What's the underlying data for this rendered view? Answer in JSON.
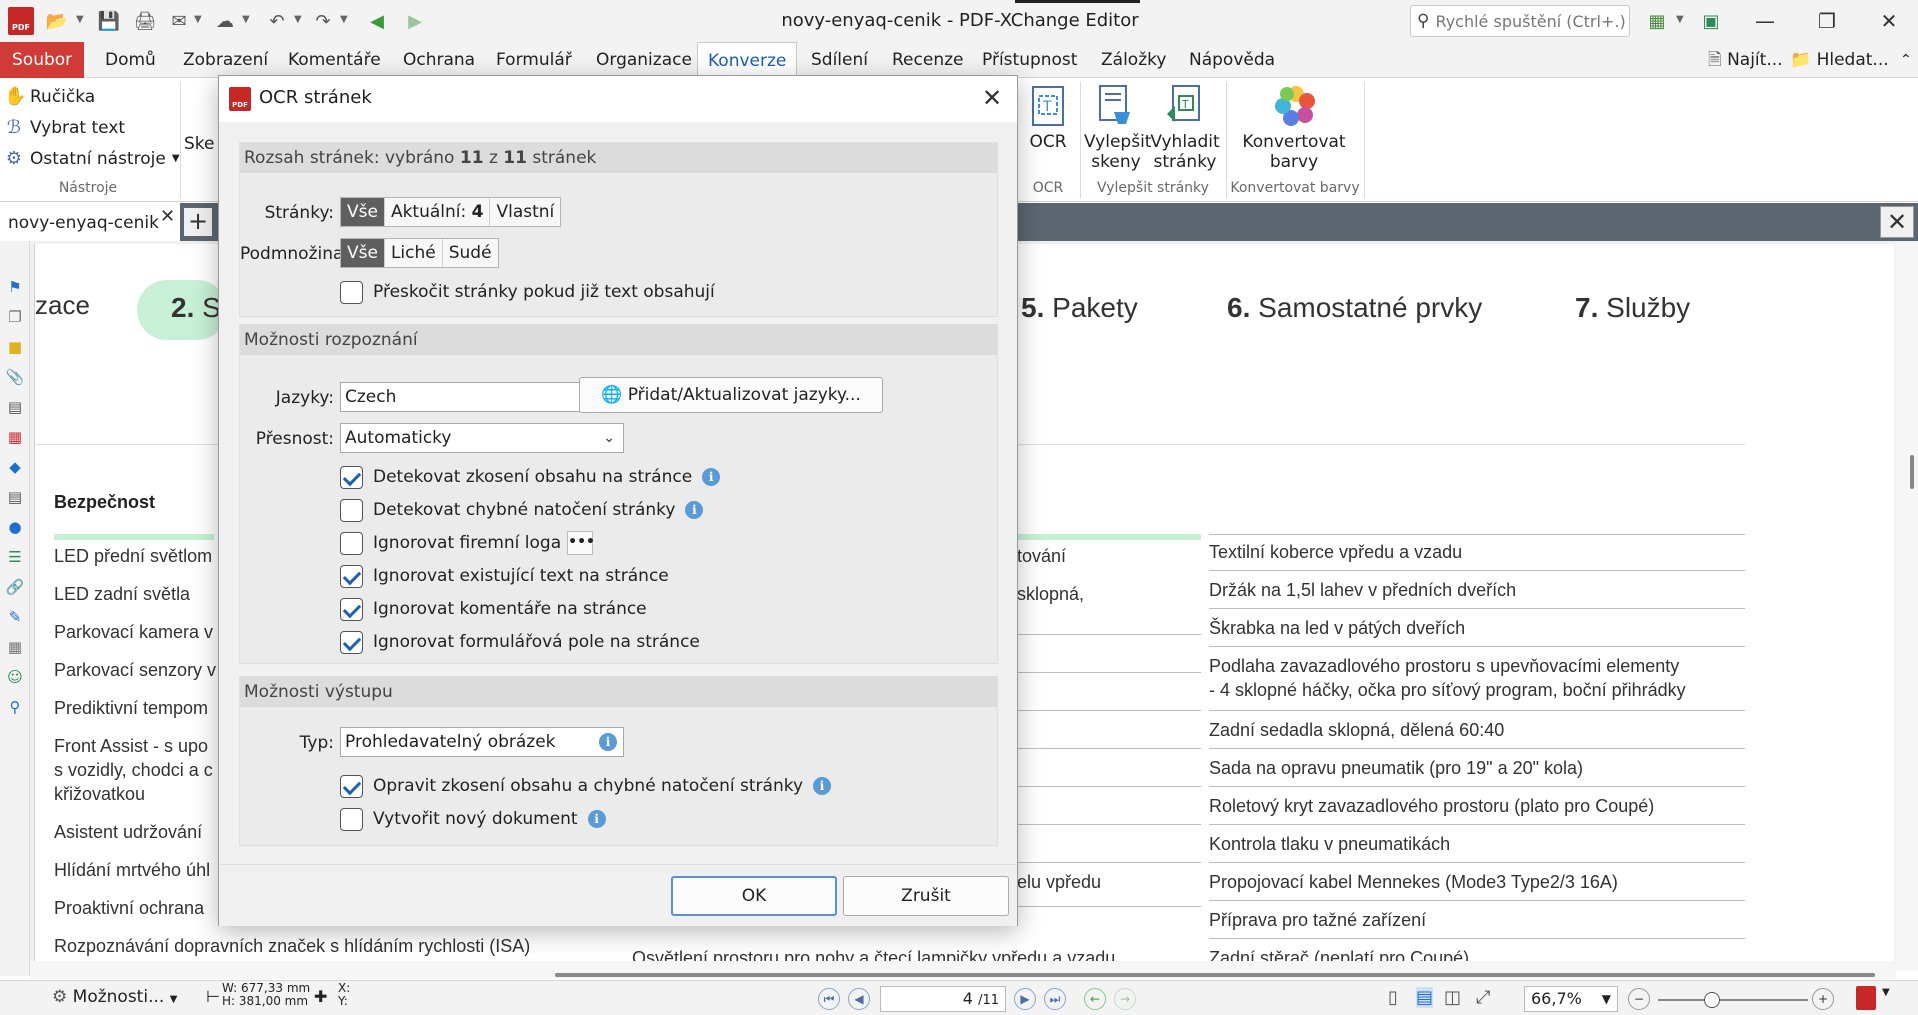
{
  "window": {
    "title": "novy-enyaq-cenik - PDF-XChange Editor",
    "quick_launch_placeholder": "Rychlé spuštění (Ctrl+.)",
    "logo_text": "PDF"
  },
  "menu": {
    "file": "Soubor",
    "items": [
      "Domů",
      "Zobrazení",
      "Komentáře",
      "Ochrana",
      "Formulář",
      "Organizace",
      "Konverze",
      "Sdílení",
      "Recenze",
      "Přístupnost",
      "Záložky",
      "Nápověda"
    ],
    "active": "Konverze",
    "find": "Najít...",
    "search": "Hledat..."
  },
  "ribbon": {
    "tools": [
      "Ručička",
      "Vybrat text",
      "Ostatní nástroje"
    ],
    "tools_group": "Nástroje",
    "partial_button": "Ske",
    "ocr_button": "OCR",
    "ocr_group": "OCR",
    "enhance_button": "Vylepšit skeny",
    "enhance_line1": "Vylepšit",
    "enhance_line2": "skeny",
    "smooth_line1": "Vyhladit",
    "smooth_line2": "stránky",
    "enhance_group": "Vylepšit stránky",
    "convert_line1": "Konvertovat",
    "convert_line2": "barvy",
    "convert_group": "Konvertovat barvy"
  },
  "tabs": {
    "doc": "novy-enyaq-cenik"
  },
  "document": {
    "steps": [
      {
        "num": "",
        "label": "zace"
      },
      {
        "num": "2.",
        "label": "S"
      },
      {
        "num": "5.",
        "label": "Pakety"
      },
      {
        "num": "6.",
        "label": "Samostatné prvky"
      },
      {
        "num": "7.",
        "label": "Služby"
      }
    ],
    "section_heading": "Bezpečnost",
    "left_items": [
      "LED přední světlom",
      "LED zadní světla",
      "Parkovací kamera v",
      "Parkovací senzory v",
      "Prediktivní tempom",
      "Front Assist - s upo",
      "s vozidly, chodci a c",
      "křižovatkou",
      "Asistent udržování",
      "Hlídání mrtvého úhl",
      "Proaktivní ochrana",
      "Rozpoznávání dopravních značek s hlídáním rychlosti (ISA)"
    ],
    "middle_items": [
      "tování",
      "sklopná,",
      "elu vpředu",
      "Osvětlení prostoru pro nohy a čtecí lampičky vpředu a vzadu"
    ],
    "right_items": [
      "Textilní koberce vpředu a vzadu",
      "Držák na 1,5l lahev v předních dveřích",
      "Škrabka na led v pátých dveřích",
      "Podlaha zavazadlového prostoru s upevňovacími elementy",
      "- 4 sklopné háčky, očka pro síťový program, boční přihrádky",
      "Zadní sedadla sklopná, dělená 60:40",
      "Sada na opravu pneumatik (pro 19\" a 20\" kola)",
      "Roletový kryt zavazadlového prostoru (plato pro Coupé)",
      "Kontrola tlaku v pneumatikách",
      "Propojovací kabel Mennekes (Mode3 Type2/3 16A)",
      "Příprava pro tažné zařízení",
      "Zadní stěrač (neplatí pro Coupé)"
    ]
  },
  "status": {
    "options": "Možnosti...",
    "width": "W: 677,33 mm",
    "height": "H: 381,00 mm",
    "x": "X:",
    "y": "Y:",
    "page": "4",
    "page_total": "/11",
    "zoom": "66,7%"
  },
  "dialog": {
    "title": "OCR stránek",
    "range_section_prefix": "Rozsah stránek: vybráno",
    "range_selected": "11",
    "range_of": "z",
    "range_total": "11",
    "range_suffix": "stránek",
    "pages_label": "Stránky:",
    "pages_options": [
      "Vše",
      "Aktuální:",
      "4",
      "Vlastní"
    ],
    "subset_label": "Podmnožina:",
    "subset_options": [
      "Vše",
      "Liché",
      "Sudé"
    ],
    "skip_text_pages": "Přeskočit stránky pokud již text obsahují",
    "recog_section": "Možnosti rozpoznání",
    "languages_label": "Jazyky:",
    "language_value": "Czech",
    "add_languages": "Přidat/Aktualizovat jazyky...",
    "accuracy_label": "Přesnost:",
    "accuracy_value": "Automaticky",
    "opt_skew": "Detekovat zkosení obsahu na stránce",
    "opt_rotation": "Detekovat chybné natočení stránky",
    "opt_logos": "Ignorovat firemní loga",
    "opt_text": "Ignorovat existující text na stránce",
    "opt_comments": "Ignorovat komentáře na stránce",
    "opt_fields": "Ignorovat formulářová pole na stránce",
    "output_section": "Možnosti výstupu",
    "type_label": "Typ:",
    "type_value": "Prohledavatelný obrázek",
    "fix_skew": "Opravit zkosení obsahu a chybné natočení stránky",
    "new_doc": "Vytvořit nový dokument",
    "ok": "OK",
    "cancel": "Zrušit"
  },
  "colors": {
    "accent_red": "#d03a37",
    "step_pill": "#c8f0d6",
    "check_blue": "#1f5fb5"
  }
}
